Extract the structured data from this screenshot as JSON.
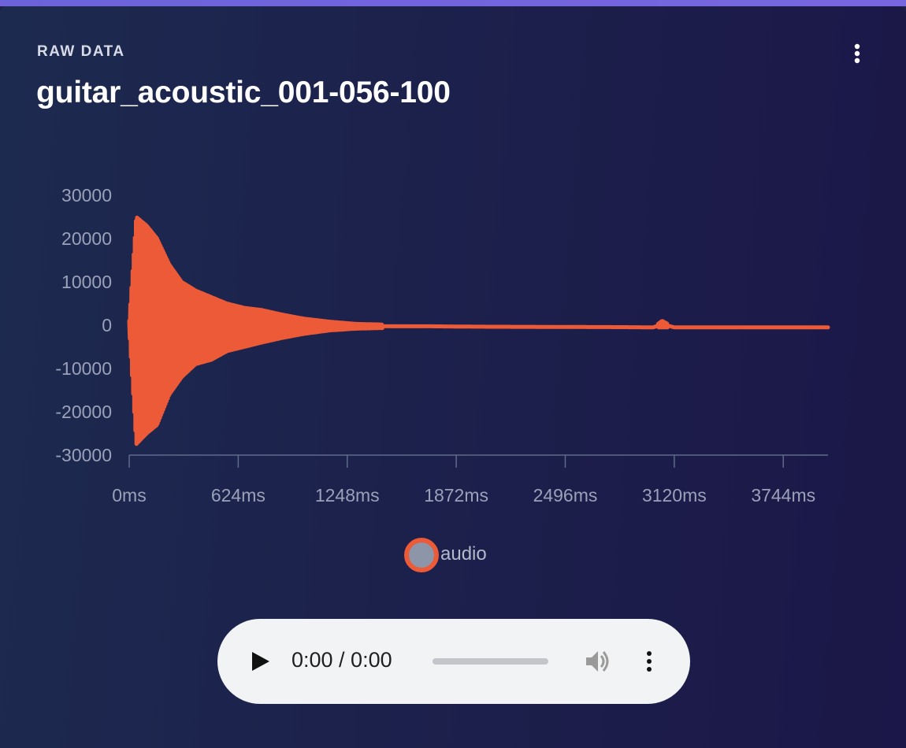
{
  "card": {
    "eyebrow": "RAW DATA",
    "title": "guitar_acoustic_001-056-100",
    "menu_icon": "more-vertical-icon"
  },
  "chart_data": {
    "type": "line",
    "series": [
      {
        "name": "audio",
        "color": "#ec5a37",
        "envelope": {
          "x_ms": [
            0,
            40,
            100,
            160,
            230,
            300,
            380,
            470,
            560,
            660,
            760,
            870,
            1000,
            1150,
            1300,
            1500,
            1700,
            2000,
            2400,
            2800,
            3000,
            3050,
            3120,
            3500,
            4000
          ],
          "max": [
            1000,
            25000,
            23000,
            20000,
            14000,
            10000,
            8000,
            6500,
            5000,
            4000,
            3500,
            2500,
            1500,
            800,
            300,
            100,
            0,
            -200,
            -300,
            -400,
            -500,
            1000,
            -500,
            -500,
            -500
          ],
          "min": [
            -1000,
            -27500,
            -25000,
            -23000,
            -16000,
            -12000,
            -9000,
            -8000,
            -6000,
            -5000,
            -4000,
            -3000,
            -2000,
            -1200,
            -800,
            -600,
            -500,
            -500,
            -500,
            -500,
            -500,
            -500,
            -500,
            -500,
            -500
          ]
        }
      }
    ],
    "x_unit": "ms",
    "x_ticks": [
      "0ms",
      "624ms",
      "1248ms",
      "1872ms",
      "2496ms",
      "3120ms",
      "3744ms"
    ],
    "x_tick_values": [
      0,
      624,
      1248,
      1872,
      2496,
      3120,
      3744
    ],
    "xlim": [
      0,
      4000
    ],
    "y_ticks": [
      "30000",
      "20000",
      "10000",
      "0",
      "-10000",
      "-20000",
      "-30000"
    ],
    "y_tick_values": [
      30000,
      20000,
      10000,
      0,
      -10000,
      -20000,
      -30000
    ],
    "ylim": [
      -30000,
      30000
    ],
    "grid": false,
    "legend": "bottom-center"
  },
  "legend": {
    "label": "audio"
  },
  "player": {
    "time": "0:00 / 0:00",
    "progress": 0,
    "play_icon": "play-icon",
    "volume_icon": "volume-icon",
    "menu_icon": "more-vertical-icon"
  }
}
